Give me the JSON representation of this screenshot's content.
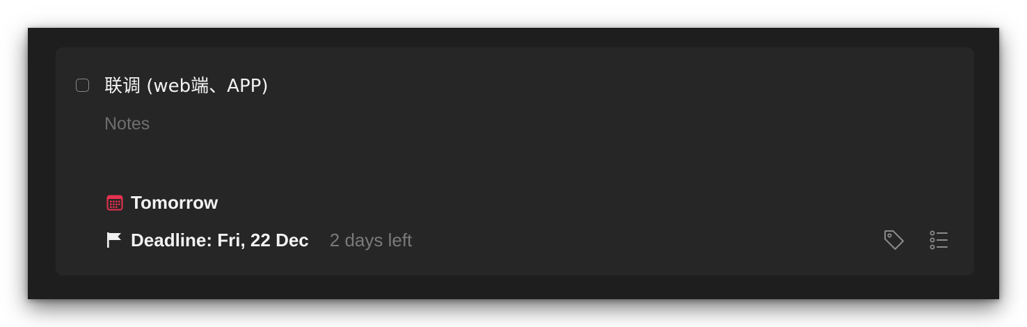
{
  "task": {
    "title": "联调 (web端、APP)",
    "notes_placeholder": "Notes",
    "when": "Tomorrow",
    "deadline": "Deadline: Fri, 22 Dec",
    "days_left": "2 days left"
  },
  "icons": {
    "checkbox": "checkbox-icon",
    "calendar": "calendar-icon",
    "flag": "flag-icon",
    "tag": "tag-icon",
    "checklist": "checklist-icon"
  },
  "colors": {
    "calendar_accent": "#e8314f",
    "background": "#1e1e1e",
    "card": "#262626",
    "text": "#f2f2f2",
    "muted": "#7a7a7a"
  }
}
